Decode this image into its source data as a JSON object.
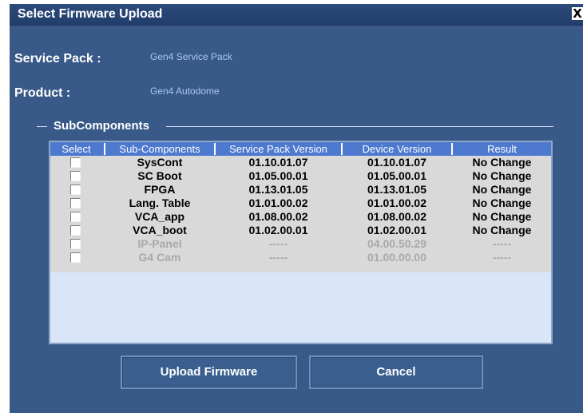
{
  "window": {
    "title": "Select Firmware Upload",
    "close_symbol": "X"
  },
  "service_pack": {
    "label": "Service Pack :",
    "value": "Gen4 Service Pack"
  },
  "product": {
    "label": "Product :",
    "value": "Gen4 Autodome"
  },
  "subcomponents": {
    "group_title": "SubComponents",
    "columns": [
      "Select",
      "Sub-Components",
      "Service Pack Version",
      "Device Version",
      "Result"
    ],
    "rows": [
      {
        "name": "SysCont",
        "service_pack_version": "01.10.01.07",
        "device_version": "01.10.01.07",
        "result": "No Change",
        "enabled": true,
        "checked": false
      },
      {
        "name": "SC Boot",
        "service_pack_version": "01.05.00.01",
        "device_version": "01.05.00.01",
        "result": "No Change",
        "enabled": true,
        "checked": false
      },
      {
        "name": "FPGA",
        "service_pack_version": "01.13.01.05",
        "device_version": "01.13.01.05",
        "result": "No Change",
        "enabled": true,
        "checked": false
      },
      {
        "name": "Lang. Table",
        "service_pack_version": "01.01.00.02",
        "device_version": "01.01.00.02",
        "result": "No Change",
        "enabled": true,
        "checked": false
      },
      {
        "name": "VCA_app",
        "service_pack_version": "01.08.00.02",
        "device_version": "01.08.00.02",
        "result": "No Change",
        "enabled": true,
        "checked": false
      },
      {
        "name": "VCA_boot",
        "service_pack_version": "01.02.00.01",
        "device_version": "01.02.00.01",
        "result": "No Change",
        "enabled": true,
        "checked": false
      },
      {
        "name": "IP-Panel",
        "service_pack_version": "-----",
        "device_version": "04.00.50.29",
        "result": "-----",
        "enabled": false,
        "checked": false
      },
      {
        "name": "G4 Cam",
        "service_pack_version": "-----",
        "device_version": "01.00.00.00",
        "result": "-----",
        "enabled": false,
        "checked": false
      }
    ]
  },
  "buttons": {
    "upload": "Upload Firmware",
    "cancel": "Cancel"
  }
}
